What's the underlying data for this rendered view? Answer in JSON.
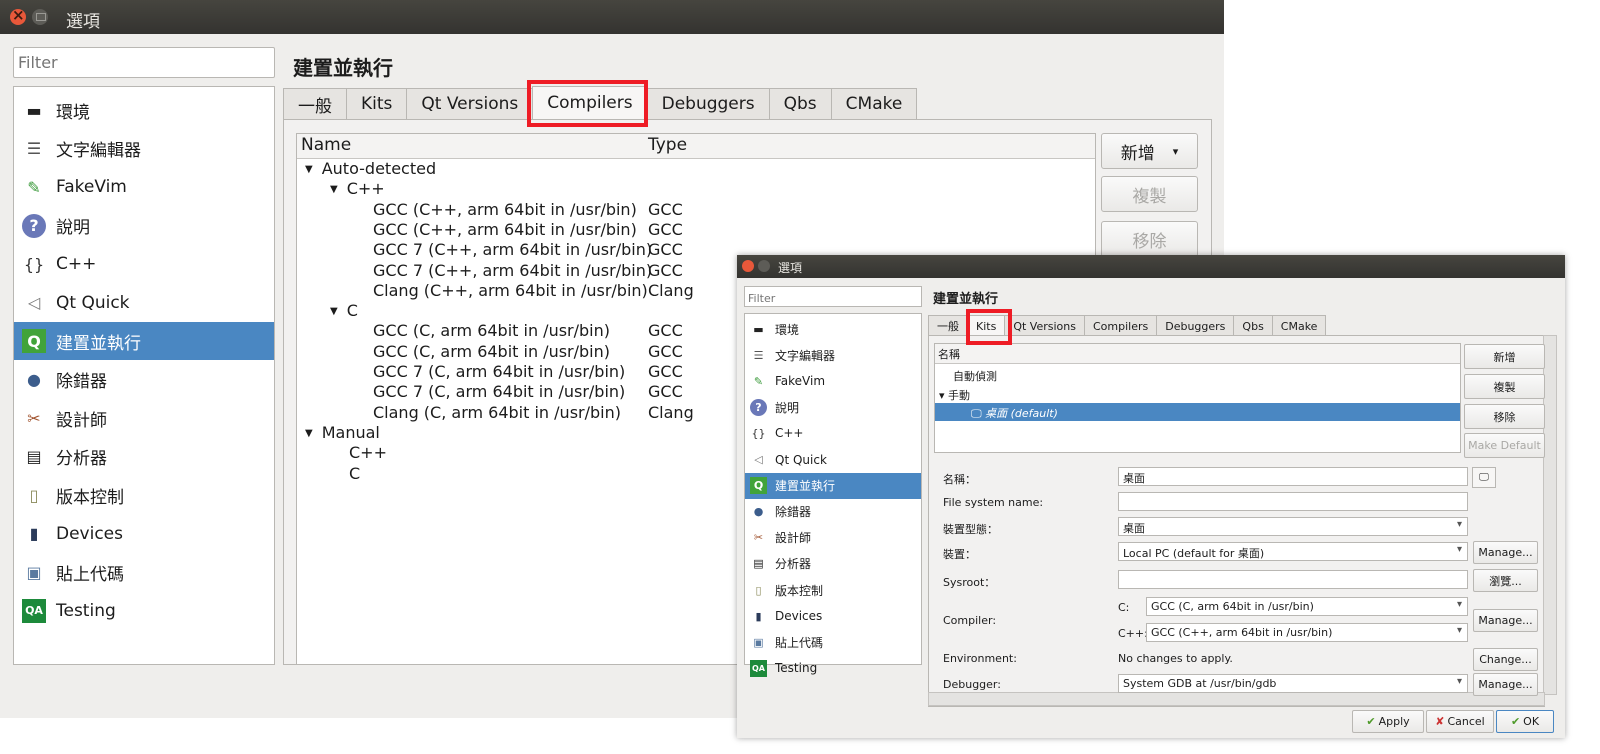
{
  "main_window": {
    "title": "選項",
    "filter_placeholder": "Filter",
    "categories": [
      {
        "label": "環境",
        "icon": "monitor-icon"
      },
      {
        "label": "文字編輯器",
        "icon": "text-editor-icon"
      },
      {
        "label": "FakeVim",
        "icon": "fakevim-icon"
      },
      {
        "label": "說明",
        "icon": "help-icon"
      },
      {
        "label": "C++",
        "icon": "braces-icon"
      },
      {
        "label": "Qt Quick",
        "icon": "paper-plane-icon"
      },
      {
        "label": "建置並執行",
        "icon": "qt-build-icon",
        "selected": true
      },
      {
        "label": "除錯器",
        "icon": "debugger-icon"
      },
      {
        "label": "設計師",
        "icon": "designer-icon"
      },
      {
        "label": "分析器",
        "icon": "analyzer-icon"
      },
      {
        "label": "版本控制",
        "icon": "version-control-icon"
      },
      {
        "label": "Devices",
        "icon": "device-icon"
      },
      {
        "label": "貼上代碼",
        "icon": "paste-code-icon"
      },
      {
        "label": "Testing",
        "icon": "qa-icon"
      }
    ],
    "page_title": "建置並執行",
    "tabs": [
      {
        "label": "一般"
      },
      {
        "label": "Kits"
      },
      {
        "label": "Qt Versions"
      },
      {
        "label": "Compilers",
        "active": true
      },
      {
        "label": "Debuggers"
      },
      {
        "label": "Qbs"
      },
      {
        "label": "CMake"
      }
    ],
    "tree_headers": {
      "name": "Name",
      "type": "Type"
    },
    "tree_rows": [
      {
        "name": "Auto-detected",
        "type": "",
        "level": 0,
        "expanded": true
      },
      {
        "name": "C++",
        "type": "",
        "level": 1,
        "expanded": true
      },
      {
        "name": "GCC (C++, arm 64bit in /usr/bin)",
        "type": "GCC",
        "level": 2
      },
      {
        "name": "GCC (C++, arm 64bit in /usr/bin)",
        "type": "GCC",
        "level": 2
      },
      {
        "name": "GCC 7 (C++, arm 64bit in /usr/bin)",
        "type": "GCC",
        "level": 2
      },
      {
        "name": "GCC 7 (C++, arm 64bit in /usr/bin)",
        "type": "GCC",
        "level": 2
      },
      {
        "name": "Clang (C++, arm 64bit in /usr/bin)",
        "type": "Clang",
        "level": 2
      },
      {
        "name": "C",
        "type": "",
        "level": 1,
        "expanded": true
      },
      {
        "name": "GCC (C, arm 64bit in /usr/bin)",
        "type": "GCC",
        "level": 2
      },
      {
        "name": "GCC (C, arm 64bit in /usr/bin)",
        "type": "GCC",
        "level": 2
      },
      {
        "name": "GCC 7 (C, arm 64bit in /usr/bin)",
        "type": "GCC",
        "level": 2
      },
      {
        "name": "GCC 7 (C, arm 64bit in /usr/bin)",
        "type": "GCC",
        "level": 2
      },
      {
        "name": "Clang (C, arm 64bit in /usr/bin)",
        "type": "Clang",
        "level": 2
      },
      {
        "name": "Manual",
        "type": "",
        "level": 0,
        "expanded": true
      },
      {
        "name": "C++",
        "type": "",
        "level": 1
      },
      {
        "name": "C",
        "type": "",
        "level": 1
      }
    ],
    "buttons": {
      "add": "新增",
      "clone": "複製",
      "remove": "移除"
    }
  },
  "kits_window": {
    "title": "選項",
    "filter_placeholder": "Filter",
    "page_title": "建置並執行",
    "tabs": [
      {
        "label": "一般"
      },
      {
        "label": "Kits",
        "active": true
      },
      {
        "label": "Qt Versions"
      },
      {
        "label": "Compilers"
      },
      {
        "label": "Debuggers"
      },
      {
        "label": "Qbs"
      },
      {
        "label": "CMake"
      }
    ],
    "kit_tree_header": "名稱",
    "kit_rows": [
      {
        "label": "自動偵測",
        "level": 1
      },
      {
        "label": "手動",
        "level": 0,
        "expanded": true
      },
      {
        "label": "桌面 (default)",
        "level": 2,
        "selected": true
      }
    ],
    "kit_buttons": {
      "add": "新增",
      "clone": "複製",
      "remove": "移除",
      "make_default": "Make Default"
    },
    "form": {
      "name_label": "名稱：",
      "name_value": "桌面",
      "fs_name_label": "File system name:",
      "fs_name_value": "",
      "device_type_label": "裝置型態：",
      "device_type_value": "桌面",
      "device_label": "裝置：",
      "device_value": "Local PC (default for 桌面)",
      "device_manage": "Manage...",
      "sysroot_label": "Sysroot：",
      "sysroot_value": "",
      "sysroot_browse": "瀏覽...",
      "compiler_label": "Compiler:",
      "compiler_c_label": "C:",
      "compiler_c_value": "GCC (C, arm 64bit in /usr/bin)",
      "compiler_cpp_label": "C++:",
      "compiler_cpp_value": "GCC (C++, arm 64bit in /usr/bin)",
      "compiler_manage": "Manage...",
      "environment_label": "Environment:",
      "environment_value": "No changes to apply.",
      "environment_change": "Change...",
      "debugger_label": "Debugger:",
      "debugger_value": "System GDB at /usr/bin/gdb",
      "debugger_manage": "Manage..."
    },
    "dialog_buttons": {
      "apply": "Apply",
      "cancel": "Cancel",
      "ok": "OK"
    }
  },
  "highlight_color": "#ee1c25",
  "selection_color": "#4a87c2"
}
